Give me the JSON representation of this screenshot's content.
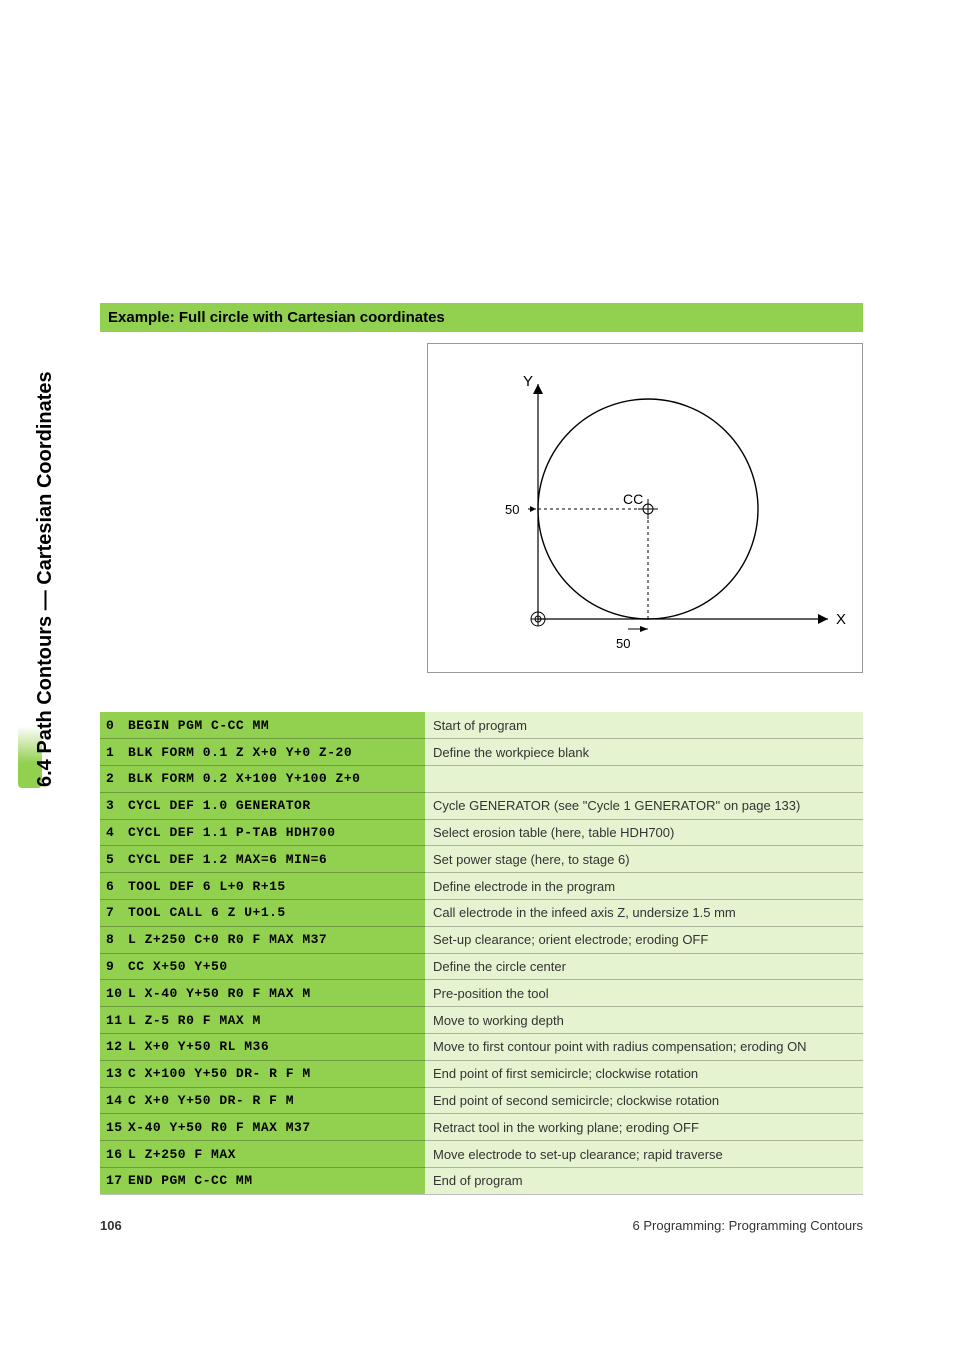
{
  "side_label": "6.4 Path Contours — Cartesian Coordinates",
  "example_title": "Example: Full circle with Cartesian coordinates",
  "diagram": {
    "y_axis": "Y",
    "x_axis": "X",
    "cc_label": "CC",
    "tick_x": "50",
    "tick_y": "50"
  },
  "rows": [
    {
      "n": "0",
      "code": "BEGIN PGM C-CC MM",
      "desc": "Start of program"
    },
    {
      "n": "1",
      "code": "BLK FORM 0.1 Z X+0 Y+0 Z-20",
      "desc": "Define the workpiece blank"
    },
    {
      "n": "2",
      "code": "BLK FORM 0.2 X+100 Y+100 Z+0",
      "desc": ""
    },
    {
      "n": "3",
      "code": "CYCL DEF 1.0 GENERATOR",
      "desc": "Cycle GENERATOR (see \"Cycle 1 GENERATOR\" on page 133)"
    },
    {
      "n": "4",
      "code": "CYCL DEF 1.1 P-TAB HDH700",
      "desc": "Select erosion table (here, table HDH700)"
    },
    {
      "n": "5",
      "code": "CYCL DEF 1.2 MAX=6 MIN=6",
      "desc": "Set power stage (here, to stage 6)"
    },
    {
      "n": "6",
      "code": "TOOL DEF 6 L+0 R+15",
      "desc": "Define electrode in the program"
    },
    {
      "n": "7",
      "code": "TOOL CALL 6 Z U+1.5",
      "desc": "Call electrode in the infeed axis Z, undersize 1.5 mm"
    },
    {
      "n": "8",
      "code": "L Z+250 C+0 R0 F MAX M37",
      "desc": "Set-up clearance; orient electrode; eroding OFF"
    },
    {
      "n": "9",
      "code": "CC X+50 Y+50",
      "desc": "Define the circle center"
    },
    {
      "n": "10",
      "code": "L X-40 Y+50 R0 F MAX M",
      "desc": "Pre-position the tool"
    },
    {
      "n": "11",
      "code": "L Z-5 R0 F MAX M",
      "desc": "Move to working depth"
    },
    {
      "n": "12",
      "code": "L X+0 Y+50 RL M36",
      "desc": "Move to first contour point with radius compensation; eroding ON"
    },
    {
      "n": "13",
      "code": "C X+100 Y+50 DR- R F M",
      "desc": "End point of first semicircle; clockwise rotation"
    },
    {
      "n": "14",
      "code": "C X+0 Y+50 DR- R F M",
      "desc": "End point of second semicircle; clockwise rotation"
    },
    {
      "n": "15",
      "code": "X-40 Y+50 R0 F MAX M37",
      "desc": "Retract tool in the working plane; eroding OFF"
    },
    {
      "n": "16",
      "code": "L Z+250 F MAX",
      "desc": "Move electrode to set-up clearance; rapid traverse"
    },
    {
      "n": "17",
      "code": "END PGM C-CC MM",
      "desc": "End of program"
    }
  ],
  "footer": {
    "page": "106",
    "chapter": "6 Programming: Programming Contours"
  },
  "chart_data": {
    "type": "diagram",
    "title": "Full circle with Cartesian coordinates",
    "axes": {
      "x": "X",
      "y": "Y"
    },
    "circle_center": {
      "x": 50,
      "y": 50,
      "label": "CC"
    },
    "circle_radius": 50,
    "tick_x": 50,
    "tick_y": 50,
    "origin": {
      "x": 0,
      "y": 0
    }
  }
}
